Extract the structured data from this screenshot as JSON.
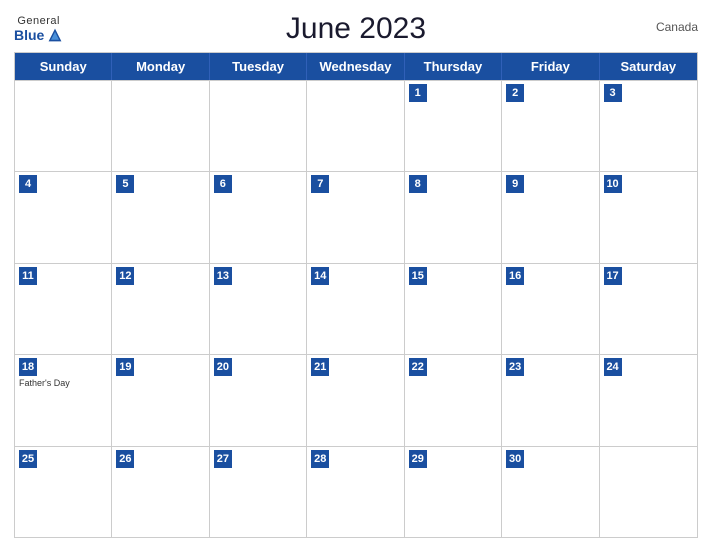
{
  "header": {
    "logo": {
      "general": "General",
      "blue": "Blue"
    },
    "title": "June 2023",
    "country": "Canada"
  },
  "dayHeaders": [
    "Sunday",
    "Monday",
    "Tuesday",
    "Wednesday",
    "Thursday",
    "Friday",
    "Saturday"
  ],
  "weeks": [
    [
      {
        "day": "",
        "empty": true
      },
      {
        "day": "",
        "empty": true
      },
      {
        "day": "",
        "empty": true
      },
      {
        "day": "",
        "empty": true
      },
      {
        "day": "1",
        "holiday": ""
      },
      {
        "day": "2",
        "holiday": ""
      },
      {
        "day": "3",
        "holiday": ""
      }
    ],
    [
      {
        "day": "4",
        "holiday": ""
      },
      {
        "day": "5",
        "holiday": ""
      },
      {
        "day": "6",
        "holiday": ""
      },
      {
        "day": "7",
        "holiday": ""
      },
      {
        "day": "8",
        "holiday": ""
      },
      {
        "day": "9",
        "holiday": ""
      },
      {
        "day": "10",
        "holiday": ""
      }
    ],
    [
      {
        "day": "11",
        "holiday": ""
      },
      {
        "day": "12",
        "holiday": ""
      },
      {
        "day": "13",
        "holiday": ""
      },
      {
        "day": "14",
        "holiday": ""
      },
      {
        "day": "15",
        "holiday": ""
      },
      {
        "day": "16",
        "holiday": ""
      },
      {
        "day": "17",
        "holiday": ""
      }
    ],
    [
      {
        "day": "18",
        "holiday": "Father's Day"
      },
      {
        "day": "19",
        "holiday": ""
      },
      {
        "day": "20",
        "holiday": ""
      },
      {
        "day": "21",
        "holiday": ""
      },
      {
        "day": "22",
        "holiday": ""
      },
      {
        "day": "23",
        "holiday": ""
      },
      {
        "day": "24",
        "holiday": ""
      }
    ],
    [
      {
        "day": "25",
        "holiday": ""
      },
      {
        "day": "26",
        "holiday": ""
      },
      {
        "day": "27",
        "holiday": ""
      },
      {
        "day": "28",
        "holiday": ""
      },
      {
        "day": "29",
        "holiday": ""
      },
      {
        "day": "30",
        "holiday": ""
      },
      {
        "day": "",
        "empty": true
      }
    ]
  ]
}
